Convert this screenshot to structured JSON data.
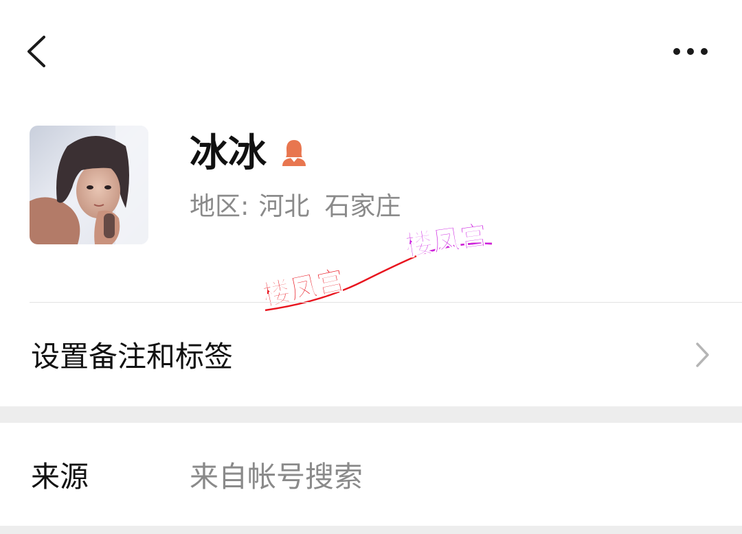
{
  "status_bar": {
    "text": "···"
  },
  "nav": {
    "back_icon": "chevron-left-icon",
    "more_icon": "more-horizontal-icon"
  },
  "profile": {
    "name": "冰冰",
    "gender_icon": "female-user-icon",
    "gender_color": "#e8764f",
    "region_label": "地区:",
    "region_province": "河北",
    "region_city": "石家庄"
  },
  "watermark": {
    "text_1": "楼凤宫",
    "text_2": "楼凤宫",
    "color_1": "#e8141e",
    "color_2": "#cc22e0"
  },
  "rows": {
    "remark_label": "设置备注和标签",
    "source_label": "来源",
    "source_value": "来自帐号搜索"
  },
  "colors": {
    "background": "#ededed",
    "card": "#ffffff",
    "primary_text": "#111111",
    "secondary_text": "#8a8a8a"
  }
}
